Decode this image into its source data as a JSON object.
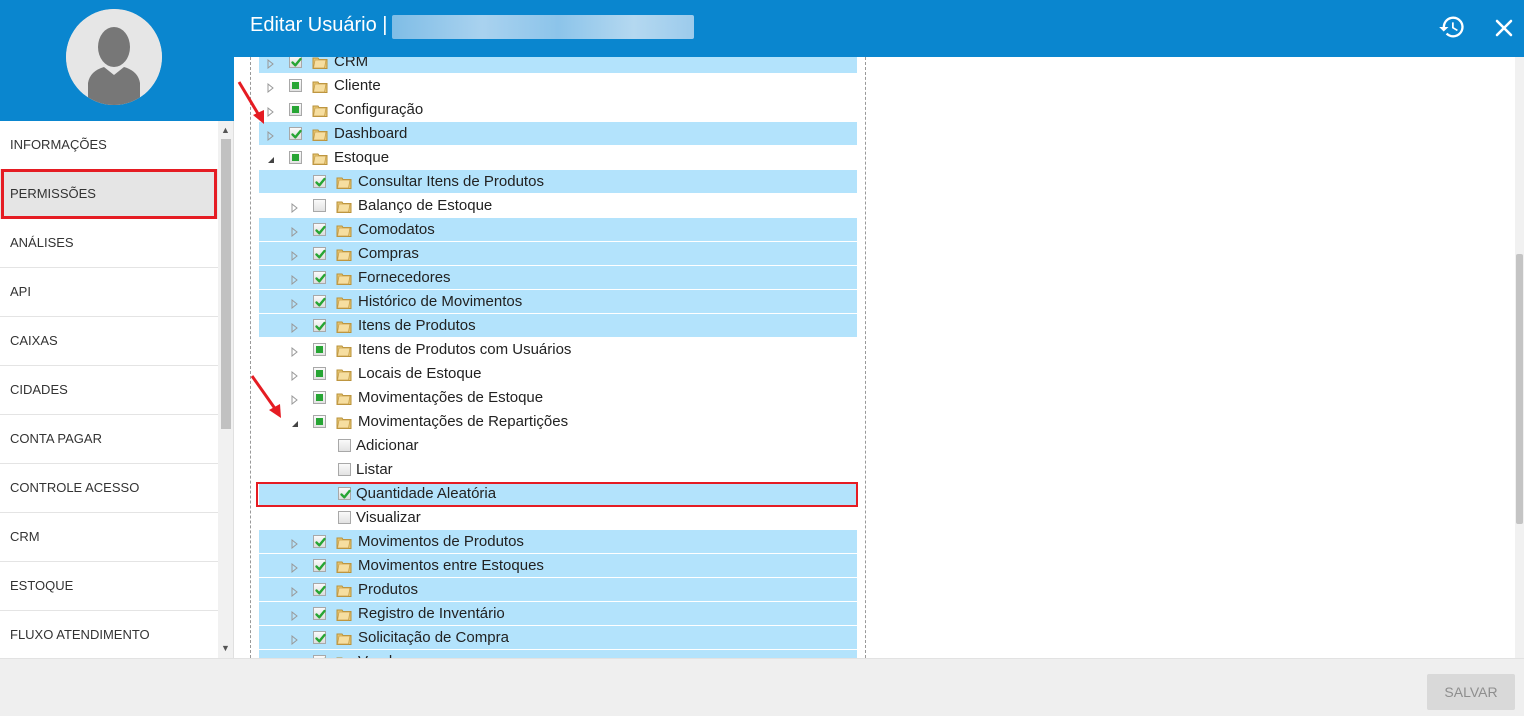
{
  "header": {
    "title": "Editar Usuário |",
    "history_icon": "history-icon",
    "close_icon": "close-icon"
  },
  "sidebar": {
    "items": [
      {
        "label": "INFORMAÇÕES"
      },
      {
        "label": "PERMISSÕES",
        "active": true
      },
      {
        "label": "ANÁLISES"
      },
      {
        "label": "API"
      },
      {
        "label": "CAIXAS"
      },
      {
        "label": "CIDADES"
      },
      {
        "label": "CONTA PAGAR"
      },
      {
        "label": "CONTROLE ACESSO"
      },
      {
        "label": "CRM"
      },
      {
        "label": "ESTOQUE"
      },
      {
        "label": "FLUXO ATENDIMENTO"
      }
    ]
  },
  "tree": {
    "rows": [
      {
        "label": "CRM",
        "level": 0,
        "state": "checked",
        "expander": "collapsed",
        "folder": true,
        "selected": true
      },
      {
        "label": "Cliente",
        "level": 0,
        "state": "partial",
        "expander": "collapsed",
        "folder": true,
        "selected": false
      },
      {
        "label": "Configuração",
        "level": 0,
        "state": "partial",
        "expander": "collapsed",
        "folder": true,
        "selected": false
      },
      {
        "label": "Dashboard",
        "level": 0,
        "state": "checked",
        "expander": "collapsed",
        "folder": true,
        "selected": true
      },
      {
        "label": "Estoque",
        "level": 0,
        "state": "partial",
        "expander": "expanded",
        "folder": true,
        "selected": false
      },
      {
        "label": "Consultar Itens de Produtos",
        "level": 1,
        "state": "checked",
        "expander": "none",
        "folder": true,
        "selected": true
      },
      {
        "label": "Balanço de Estoque",
        "level": 1,
        "state": "unchecked",
        "expander": "collapsed",
        "folder": true,
        "selected": false
      },
      {
        "label": "Comodatos",
        "level": 1,
        "state": "checked",
        "expander": "collapsed",
        "folder": true,
        "selected": true
      },
      {
        "label": "Compras",
        "level": 1,
        "state": "checked",
        "expander": "collapsed",
        "folder": true,
        "selected": true
      },
      {
        "label": "Fornecedores",
        "level": 1,
        "state": "checked",
        "expander": "collapsed",
        "folder": true,
        "selected": true
      },
      {
        "label": "Histórico de Movimentos",
        "level": 1,
        "state": "checked",
        "expander": "collapsed",
        "folder": true,
        "selected": true
      },
      {
        "label": "Itens de Produtos",
        "level": 1,
        "state": "checked",
        "expander": "collapsed",
        "folder": true,
        "selected": true
      },
      {
        "label": "Itens de Produtos com Usuários",
        "level": 1,
        "state": "partial",
        "expander": "collapsed",
        "folder": true,
        "selected": false
      },
      {
        "label": "Locais de Estoque",
        "level": 1,
        "state": "partial",
        "expander": "collapsed",
        "folder": true,
        "selected": false
      },
      {
        "label": "Movimentações de Estoque",
        "level": 1,
        "state": "partial",
        "expander": "collapsed",
        "folder": true,
        "selected": false
      },
      {
        "label": "Movimentações de Repartições",
        "level": 1,
        "state": "partial",
        "expander": "expanded",
        "folder": true,
        "selected": false
      },
      {
        "label": "Adicionar",
        "level": 2,
        "state": "unchecked",
        "expander": "none",
        "folder": false,
        "selected": false
      },
      {
        "label": "Listar",
        "level": 2,
        "state": "unchecked",
        "expander": "none",
        "folder": false,
        "selected": false
      },
      {
        "label": "Quantidade Aleatória",
        "level": 2,
        "state": "checked",
        "expander": "none",
        "folder": false,
        "selected": true
      },
      {
        "label": "Visualizar",
        "level": 2,
        "state": "unchecked",
        "expander": "none",
        "folder": false,
        "selected": false
      },
      {
        "label": "Movimentos de Produtos",
        "level": 1,
        "state": "checked",
        "expander": "collapsed",
        "folder": true,
        "selected": true
      },
      {
        "label": "Movimentos entre Estoques",
        "level": 1,
        "state": "checked",
        "expander": "collapsed",
        "folder": true,
        "selected": true
      },
      {
        "label": "Produtos",
        "level": 1,
        "state": "checked",
        "expander": "collapsed",
        "folder": true,
        "selected": true
      },
      {
        "label": "Registro de Inventário",
        "level": 1,
        "state": "checked",
        "expander": "collapsed",
        "folder": true,
        "selected": true
      },
      {
        "label": "Solicitação de Compra",
        "level": 1,
        "state": "checked",
        "expander": "collapsed",
        "folder": true,
        "selected": true
      },
      {
        "label": "Vendas",
        "level": 1,
        "state": "checked",
        "expander": "collapsed",
        "folder": true,
        "selected": true
      }
    ]
  },
  "footer": {
    "save_label": "SALVAR"
  },
  "colors": {
    "primary": "#0a86cf",
    "selected_row": "#b3e3fc",
    "highlight_red": "#e51c23",
    "check_green": "#27a534"
  }
}
